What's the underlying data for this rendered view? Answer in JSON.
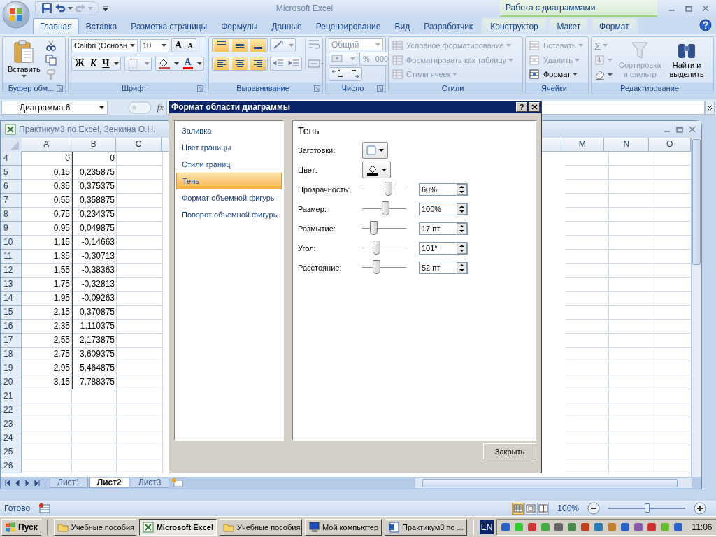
{
  "title_bar": {
    "title": "Microsoft Excel",
    "context_title": "Работа с диаграммами"
  },
  "tabs": [
    {
      "label": "Главная",
      "selected": true,
      "contextual": false
    },
    {
      "label": "Вставка",
      "selected": false,
      "contextual": false
    },
    {
      "label": "Разметка страницы",
      "selected": false,
      "contextual": false
    },
    {
      "label": "Формулы",
      "selected": false,
      "contextual": false
    },
    {
      "label": "Данные",
      "selected": false,
      "contextual": false
    },
    {
      "label": "Рецензирование",
      "selected": false,
      "contextual": false
    },
    {
      "label": "Вид",
      "selected": false,
      "contextual": false
    },
    {
      "label": "Разработчик",
      "selected": false,
      "contextual": false
    },
    {
      "label": "Конструктор",
      "selected": false,
      "contextual": true
    },
    {
      "label": "Макет",
      "selected": false,
      "contextual": true
    },
    {
      "label": "Формат",
      "selected": false,
      "contextual": true
    }
  ],
  "ribbon": {
    "clipboard": {
      "paste": "Вставить",
      "label": "Буфер обм..."
    },
    "font": {
      "font_name": "Calibri (Основн",
      "font_size": "10",
      "grow": "A",
      "shrink": "A",
      "bold": "Ж",
      "italic": "К",
      "underline": "Ч",
      "font_color": "A",
      "label": "Шрифт"
    },
    "alignment": {
      "buttons": [
        {
          "kind": "top",
          "selected": true
        },
        {
          "kind": "middle",
          "selected": true
        },
        {
          "kind": "bottom",
          "selected": true
        },
        {
          "kind": "left",
          "selected": true
        },
        {
          "kind": "center",
          "selected": true
        },
        {
          "kind": "right",
          "selected": true
        }
      ],
      "label": "Выравнивание"
    },
    "number": {
      "format": "Общий",
      "percent": "%",
      "thousands": "000",
      "disabled": true,
      "label": "Число"
    },
    "styles": {
      "items": [
        {
          "label": "Условное форматирование",
          "disabled": true
        },
        {
          "label": "Форматировать как таблицу",
          "disabled": true
        },
        {
          "label": "Стили ячеек",
          "disabled": true
        }
      ],
      "label": "Стили"
    },
    "cells": {
      "items": [
        {
          "label": "Вставить",
          "disabled": true
        },
        {
          "label": "Удалить",
          "disabled": true
        },
        {
          "label": "Формат",
          "disabled": false
        }
      ],
      "label": "Ячейки"
    },
    "editing": {
      "sigma": "Σ",
      "sort": {
        "lines": [
          "Сортировка",
          "и фильтр"
        ],
        "disabled": true
      },
      "find": {
        "lines": [
          "Найти и",
          "выделить"
        ],
        "disabled": false
      },
      "label": "Редактирование"
    }
  },
  "formula_bar": {
    "name_box": "Диаграмма 6",
    "fx": "fx"
  },
  "workbook": {
    "title": "Практикум3 по Excel, Зенкина О.Н.",
    "columns_left": [
      "A",
      "B",
      "C"
    ],
    "columns_right": [
      "M",
      "N",
      "O"
    ],
    "rows": [
      {
        "num": "4",
        "a": "0",
        "b": "0"
      },
      {
        "num": "5",
        "a": "0,15",
        "b": "0,235875"
      },
      {
        "num": "6",
        "a": "0,35",
        "b": "0,375375"
      },
      {
        "num": "7",
        "a": "0,55",
        "b": "0,358875"
      },
      {
        "num": "8",
        "a": "0,75",
        "b": "0,234375"
      },
      {
        "num": "9",
        "a": "0,95",
        "b": "0,049875"
      },
      {
        "num": "10",
        "a": "1,15",
        "b": "-0,14663"
      },
      {
        "num": "11",
        "a": "1,35",
        "b": "-0,30713"
      },
      {
        "num": "12",
        "a": "1,55",
        "b": "-0,38363"
      },
      {
        "num": "13",
        "a": "1,75",
        "b": "-0,32813"
      },
      {
        "num": "14",
        "a": "1,95",
        "b": "-0,09263"
      },
      {
        "num": "15",
        "a": "2,15",
        "b": "0,370875"
      },
      {
        "num": "16",
        "a": "2,35",
        "b": "1,110375"
      },
      {
        "num": "17",
        "a": "2,55",
        "b": "2,173875"
      },
      {
        "num": "18",
        "a": "2,75",
        "b": "3,609375"
      },
      {
        "num": "19",
        "a": "2,95",
        "b": "5,464875"
      },
      {
        "num": "20",
        "a": "3,15",
        "b": "7,788375"
      },
      {
        "num": "21"
      },
      {
        "num": "22"
      },
      {
        "num": "23"
      },
      {
        "num": "24"
      },
      {
        "num": "25"
      },
      {
        "num": "26"
      }
    ],
    "sheet_tabs": [
      {
        "label": "Лист1",
        "selected": false
      },
      {
        "label": "Лист2",
        "selected": true
      },
      {
        "label": "Лист3",
        "selected": false
      }
    ]
  },
  "status_bar": {
    "status": "Готово",
    "views": [
      {
        "kind": "normal",
        "selected": true
      },
      {
        "kind": "page-layout",
        "selected": false
      },
      {
        "kind": "page-break",
        "selected": false
      }
    ],
    "zoom": "100%",
    "level": 0.5
  },
  "dialog": {
    "title": "Формат области диаграммы",
    "help": "?",
    "nav": [
      {
        "label": "Заливка",
        "selected": false
      },
      {
        "label": "Цвет границы",
        "selected": false
      },
      {
        "label": "Стили границ",
        "selected": false
      },
      {
        "label": "Тень",
        "selected": true
      },
      {
        "label": "Формат объемной фигуры",
        "selected": false
      },
      {
        "label": "Поворот объемной фигуры",
        "selected": false
      }
    ],
    "heading": "Тень",
    "presets_label": "Заготовки:",
    "color_label": "Цвет:",
    "settings": [
      {
        "label": "Прозрачность:",
        "value": "60%",
        "level": 0.58
      },
      {
        "label": "Размер:",
        "value": "100%",
        "level": 0.52
      },
      {
        "label": "Размытие:",
        "value": "17 пт",
        "level": 0.25
      },
      {
        "label": "Угол:",
        "value": "101°",
        "level": 0.31
      },
      {
        "label": "Расстояние:",
        "value": "52 пт",
        "level": 0.31
      }
    ],
    "close": "Закрыть"
  },
  "taskbar": {
    "start": "Пуск",
    "buttons": [
      {
        "label": "Учебные пособия",
        "kind": "folder",
        "selected": false
      },
      {
        "label": "Microsoft Excel",
        "kind": "excel",
        "selected": true
      },
      {
        "label": "Учебные пособия",
        "kind": "folder",
        "selected": false
      },
      {
        "label": "Мой компьютер",
        "kind": "computer",
        "selected": false
      },
      {
        "label": "Практикум3 по ...",
        "kind": "word",
        "selected": false
      }
    ],
    "language": "EN",
    "clock": "11:06"
  }
}
